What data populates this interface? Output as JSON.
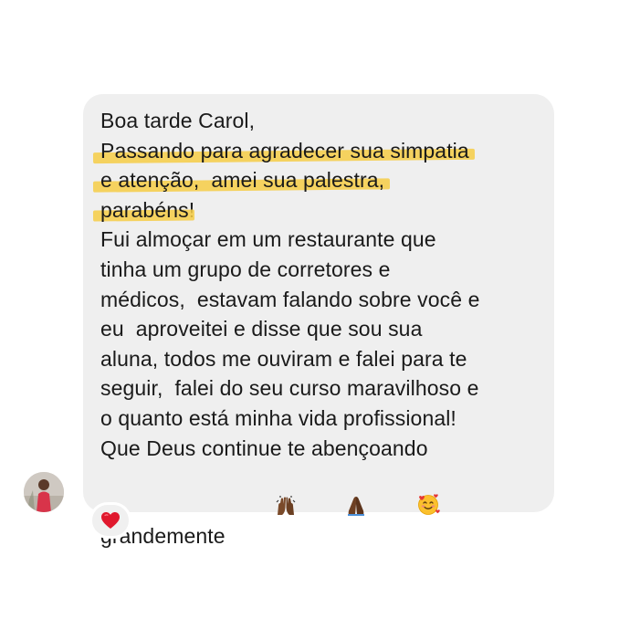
{
  "message": {
    "lines": [
      "Boa tarde Carol,",
      "Passando para agradecer sua simpatia",
      "e atenção,  amei sua palestra,",
      "parabéns",
      "!",
      "Fui almoçar em um restaurante que",
      "tinha um grupo de corretores e",
      "médicos,  estavam falando sobre você e",
      "eu  aproveitei e disse que sou sua",
      "aluna, todos me ouviram e falei para te",
      "seguir,  falei do seu curso maravilhoso e",
      "o quanto está minha vida profissional!",
      "Que Deus continue te abençoando",
      "grandemente"
    ],
    "emojis": [
      "raising-hands-emoji",
      "folded-hands-emoji",
      "smiling-face-with-hearts-emoji"
    ]
  },
  "reaction": {
    "icon": "red-heart-icon"
  },
  "colors": {
    "bubble": "#efefef",
    "highlight": "#f6cd45",
    "text": "#1a1a1a",
    "heart": "#e0182d"
  }
}
